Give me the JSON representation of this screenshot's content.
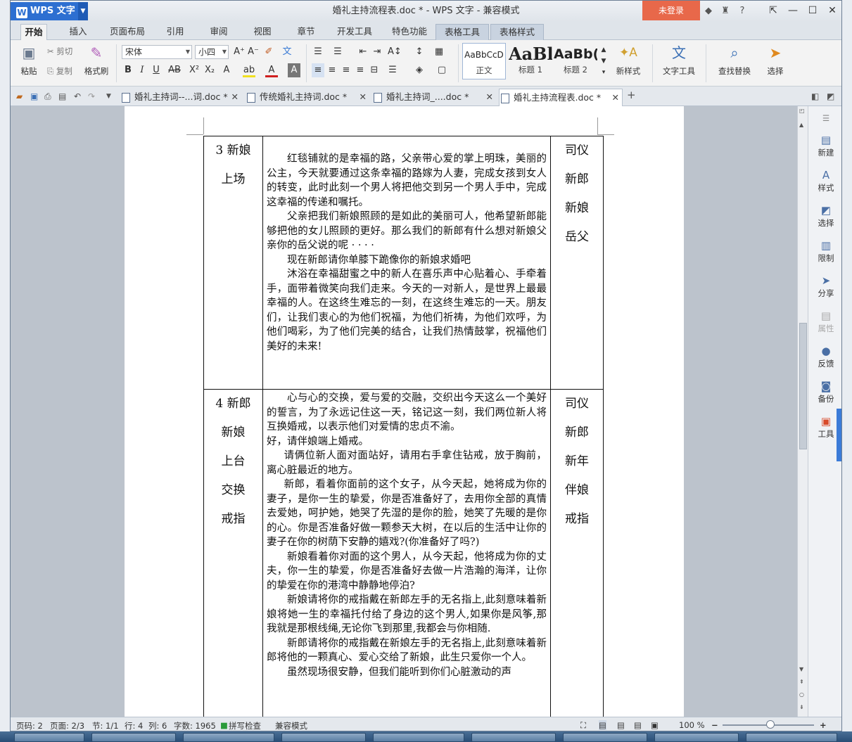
{
  "window": {
    "app_name": "WPS 文字",
    "title": "婚礼主持流程表.doc * - WPS 文字 - 兼容模式",
    "login_label": "未登录",
    "title_icons": [
      "shirt-icon",
      "skin-icon",
      "help-icon"
    ]
  },
  "ribbon_tabs": [
    "开始",
    "插入",
    "页面布局",
    "引用",
    "审阅",
    "视图",
    "章节",
    "开发工具",
    "特色功能",
    "表格工具",
    "表格样式"
  ],
  "ribbon": {
    "paste": "粘贴",
    "cut": "剪切",
    "copy": "复制",
    "format_painter": "格式刷",
    "font_name": "宋体",
    "font_size": "小四",
    "styles": [
      {
        "sample": "AaBbCcD",
        "label": "正文"
      },
      {
        "sample": "AaBl",
        "label": "标题 1"
      },
      {
        "sample": "AaBb(",
        "label": "标题 2"
      }
    ],
    "new_style": "新样式",
    "text_tools": "文字工具",
    "find_replace": "查找替换",
    "select": "选择"
  },
  "doc_tabs": [
    {
      "label": "婚礼主持词--...词.doc *",
      "active": false
    },
    {
      "label": "传统婚礼主持词.doc *",
      "active": false
    },
    {
      "label": "婚礼主持词_....doc *",
      "active": false
    },
    {
      "label": "婚礼主持流程表.doc *",
      "active": true
    }
  ],
  "table": {
    "rows": [
      {
        "step": [
          "3 新娘",
          "上场"
        ],
        "people": [
          "司仪",
          "新郎",
          "新娘",
          "岳父"
        ],
        "paragraphs": [
          {
            "indent": "ind",
            "text": "红毯铺就的是幸福的路，父亲带心爱的掌上明珠，美丽的公主，今天就要通过这条幸福的路嫁为人妻，完成女孩到女人的转变，此时此刻一个男人将把他交到另一个男人手中，完成这幸福的传递和嘱托。"
          },
          {
            "indent": "ind",
            "text": "父亲把我们新娘照顾的是如此的美丽可人，他希望新郎能够把他的女儿照顾的更好。那么我们的新郎有什么想对新娘父亲你的岳父说的呢 · · · ·"
          },
          {
            "indent": "ind",
            "text": "现在新郎请你单膝下跪像你的新娘求婚吧"
          },
          {
            "indent": "ind",
            "text": "沐浴在幸福甜蜜之中的新人在喜乐声中心贴着心、手牵着手，面带着微笑向我们走来。今天的一对新人，是世界上最最幸福的人。在这终生难忘的一刻，在这终生难忘的一天。朋友们，让我们衷心的为他们祝福，为他们祈祷，为他们欢呼，为他们喝彩，为了他们完美的结合，让我们热情鼓掌，祝福他们美好的未来!"
          }
        ]
      },
      {
        "step": [
          "4 新郎",
          "新娘",
          "上台",
          "交换",
          "戒指"
        ],
        "people": [
          "司仪",
          "新郎",
          "新年",
          "伴娘",
          "戒指"
        ],
        "paragraphs": [
          {
            "indent": "ind",
            "text": "心与心的交换，爱与爱的交融，交织出今天这么一个美好的誓言，为了永远记住这一天，铭记这一刻，我们两位新人将互换婚戒，以表示他们对爱情的忠贞不渝。"
          },
          {
            "indent": "",
            "text": "好，请伴娘端上婚戒。"
          },
          {
            "indent": "ind1",
            "text": "请俩位新人面对面站好，请用右手拿住钻戒，放于胸前，离心脏最近的地方。"
          },
          {
            "indent": "ind1",
            "text": "新郎，看着你面前的这个女子，从今天起，她将成为你的妻子，是你一生的挚爱，你是否准备好了，去用你全部的真情去爱她，呵护她，她哭了先湿的是你的脸，她笑了先暖的是你的心。你是否准备好做一颗参天大树，在以后的生活中让你的妻子在你的树荫下安静的嬉戏?(你准备好了吗?)"
          },
          {
            "indent": "ind",
            "text": "新娘看着你对面的这个男人，从今天起，他将成为你的丈夫，你一生的挚爱，你是否准备好去做一片浩瀚的海洋，让你的挚爱在你的港湾中静静地停泊?"
          },
          {
            "indent": "ind",
            "text": "新娘请将你的戒指戴在新郎左手的无名指上,此刻意味着新娘将她一生的幸福托付给了身边的这个男人,如果你是风筝,那我就是那根线绳,无论你飞到那里,我都会与你相随."
          },
          {
            "indent": "ind",
            "text": "新郎请将你的戒指戴在新娘左手的无名指上,此刻意味着新郎将他的一颗真心、爱心交给了新娘，此生只爱你一个人。"
          },
          {
            "indent": "ind",
            "text": "虽然现场很安静，但我们能听到你们心脏激动的声"
          }
        ]
      }
    ]
  },
  "side_panel": [
    {
      "icon": "new-doc-icon",
      "label": "新建",
      "dim": false
    },
    {
      "icon": "style-icon",
      "label": "样式",
      "dim": false
    },
    {
      "icon": "select-icon",
      "label": "选择",
      "dim": false
    },
    {
      "icon": "restrict-icon",
      "label": "限制",
      "dim": false
    },
    {
      "icon": "share-icon",
      "label": "分享",
      "dim": false
    },
    {
      "icon": "properties-icon",
      "label": "属性",
      "dim": true
    },
    {
      "icon": "feedback-icon",
      "label": "反馈",
      "dim": false
    },
    {
      "icon": "backup-icon",
      "label": "备份",
      "dim": false
    },
    {
      "icon": "toolbox-icon",
      "label": "工具",
      "dim": false
    }
  ],
  "status": {
    "page_no": "页码: 2",
    "pages": "页面: 2/3",
    "section": "节: 1/1",
    "row": "行: 4",
    "col": "列: 6",
    "words": "字数: 1965",
    "spell": "拼写检查",
    "compat": "兼容模式",
    "zoom": "100 %"
  }
}
